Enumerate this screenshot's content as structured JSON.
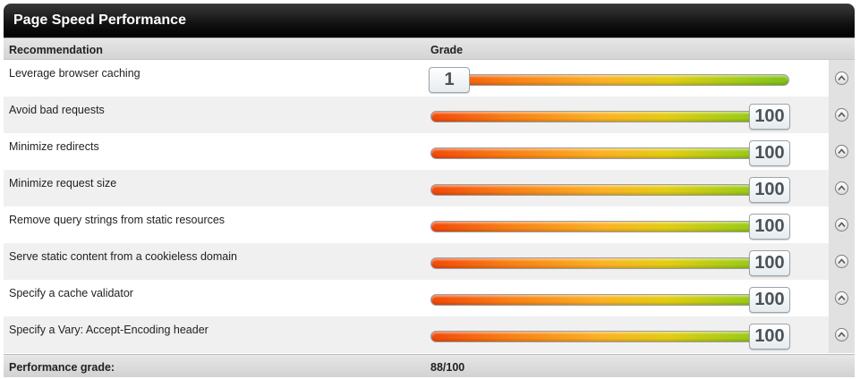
{
  "panel": {
    "title": "Page Speed Performance"
  },
  "columns": {
    "recommendation": "Recommendation",
    "grade": "Grade"
  },
  "rows": [
    {
      "label": "Leverage browser caching",
      "grade": "1"
    },
    {
      "label": "Avoid bad requests",
      "grade": "100"
    },
    {
      "label": "Minimize redirects",
      "grade": "100"
    },
    {
      "label": "Minimize request size",
      "grade": "100"
    },
    {
      "label": "Remove query strings from static resources",
      "grade": "100"
    },
    {
      "label": "Serve static content from a cookieless domain",
      "grade": "100"
    },
    {
      "label": "Specify a cache validator",
      "grade": "100"
    },
    {
      "label": "Specify a Vary: Accept-Encoding header",
      "grade": "100"
    }
  ],
  "footer": {
    "label": "Performance grade:",
    "value": "88/100"
  },
  "icons": {
    "row_action": "expand-circle-up-icon"
  },
  "colors": {
    "title_bg": "#000000",
    "bar_low": "#f24a0a",
    "bar_mid": "#fbb224",
    "bar_high": "#7fc21a"
  }
}
